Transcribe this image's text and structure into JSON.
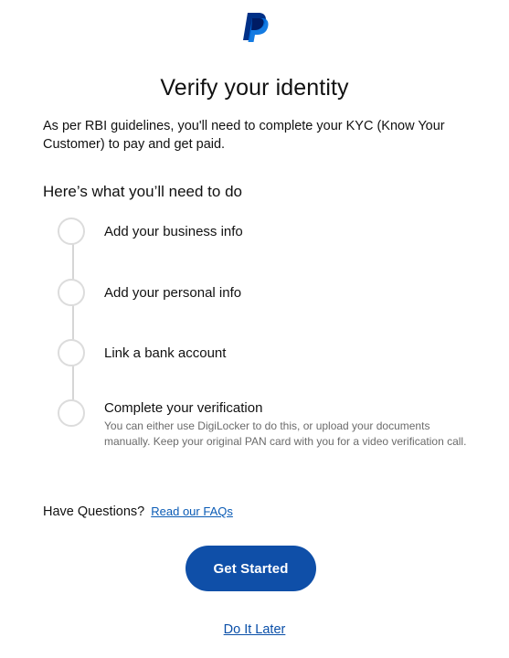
{
  "brand": {
    "logo_icon": "paypal-logo-icon",
    "colors": {
      "primary_dark": "#003087",
      "primary_light": "#0070e0",
      "button": "#0f4fa8",
      "link": "#0a5bb5"
    }
  },
  "page": {
    "title": "Verify your identity",
    "intro": "As per RBI guidelines, you'll need to complete your KYC (Know Your Customer) to pay and get paid.",
    "steps_heading": "Here’s what you’ll need to do"
  },
  "steps": [
    {
      "label": "Add your business info"
    },
    {
      "label": "Add your personal info"
    },
    {
      "label": "Link a bank account"
    },
    {
      "label": "Complete your verification",
      "description": "You can either use DigiLocker to do this, or upload your documents manually. Keep your original PAN card with you for a video verification call."
    }
  ],
  "faq": {
    "prompt": "Have Questions?",
    "link_label": "Read our FAQs"
  },
  "actions": {
    "primary_label": "Get Started",
    "secondary_label": "Do It Later"
  }
}
